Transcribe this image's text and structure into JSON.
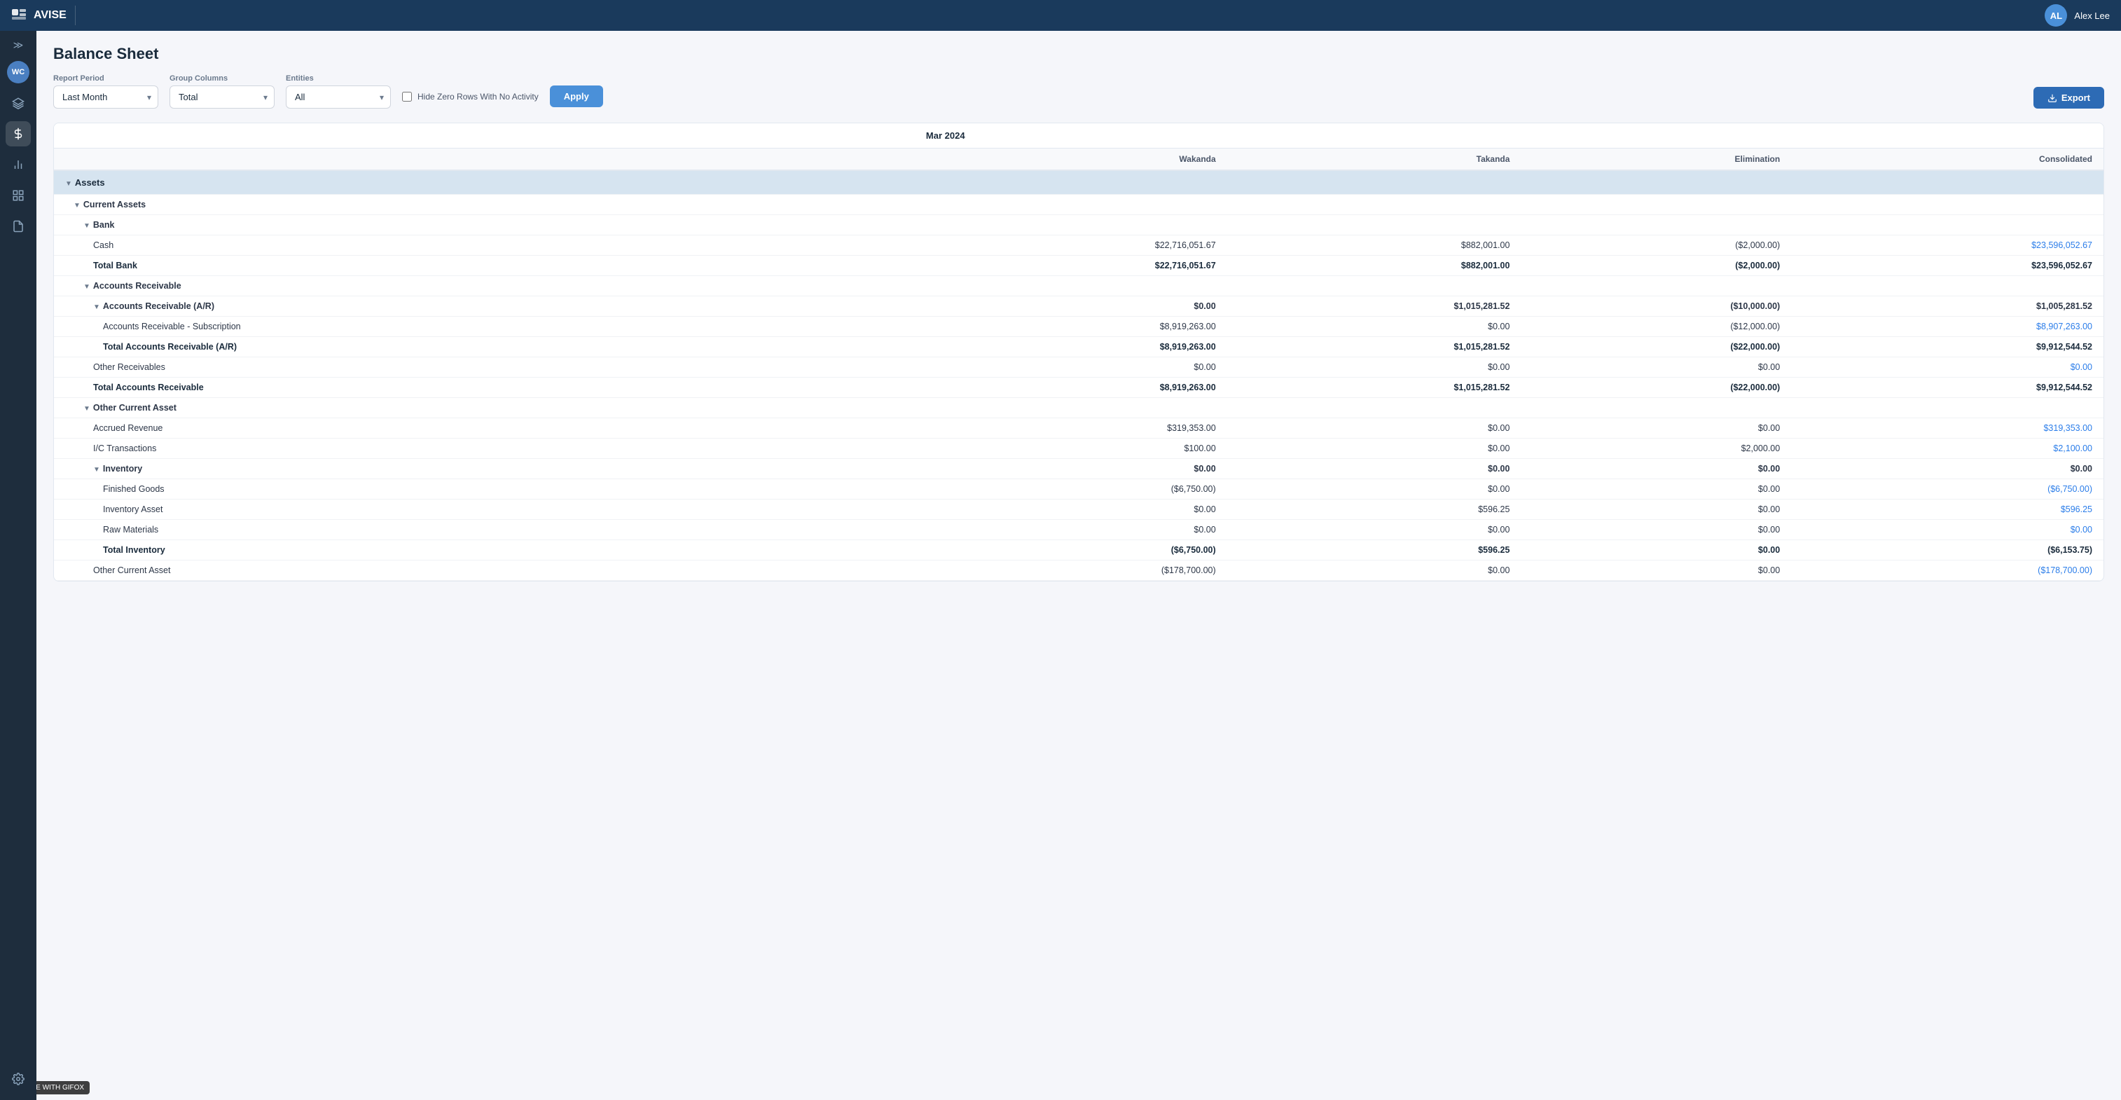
{
  "app": {
    "name": "AVISE",
    "user": "Alex Lee",
    "user_initials": "AL"
  },
  "page": {
    "title": "Balance Sheet"
  },
  "filters": {
    "report_period_label": "Report Period",
    "report_period_value": "Last Month",
    "group_columns_label": "Group Columns",
    "group_columns_value": "Total",
    "entities_label": "Entities",
    "entities_value": "All",
    "hide_zero_label": "Hide Zero Rows With No Activity",
    "apply_label": "Apply",
    "export_label": "Export"
  },
  "table": {
    "date_header": "Mar 2024",
    "columns": [
      "",
      "Wakanda",
      "Takanda",
      "Elimination",
      "Consolidated"
    ],
    "sections": [
      {
        "name": "Assets",
        "rows": [
          {
            "type": "category",
            "indent": 1,
            "label": "Current Assets",
            "chevron": true,
            "wakanda": "",
            "takanda": "",
            "elimination": "",
            "consolidated": ""
          },
          {
            "type": "subcategory",
            "indent": 2,
            "label": "Bank",
            "chevron": true,
            "wakanda": "",
            "takanda": "",
            "elimination": "",
            "consolidated": ""
          },
          {
            "type": "data",
            "indent": 3,
            "label": "Cash",
            "wakanda": "$22,716,051.67",
            "takanda": "$882,001.00",
            "elimination": "($2,000.00)",
            "consolidated": "$23,596,052.67",
            "consolidated_blue": true
          },
          {
            "type": "total",
            "indent": 3,
            "label": "Total Bank",
            "wakanda": "$22,716,051.67",
            "takanda": "$882,001.00",
            "elimination": "($2,000.00)",
            "consolidated": "$23,596,052.67"
          },
          {
            "type": "subcategory",
            "indent": 2,
            "label": "Accounts Receivable",
            "chevron": true,
            "wakanda": "",
            "takanda": "",
            "elimination": "",
            "consolidated": ""
          },
          {
            "type": "subcategory",
            "indent": 3,
            "label": "Accounts Receivable (A/R)",
            "chevron": true,
            "wakanda": "$0.00",
            "takanda": "$1,015,281.52",
            "elimination": "($10,000.00)",
            "consolidated": "$1,005,281.52",
            "consolidated_blue": true
          },
          {
            "type": "data",
            "indent": 4,
            "label": "Accounts Receivable - Subscription",
            "wakanda": "$8,919,263.00",
            "takanda": "$0.00",
            "elimination": "($12,000.00)",
            "consolidated": "$8,907,263.00",
            "consolidated_blue": true
          },
          {
            "type": "total",
            "indent": 4,
            "label": "Total Accounts Receivable (A/R)",
            "wakanda": "$8,919,263.00",
            "takanda": "$1,015,281.52",
            "elimination": "($22,000.00)",
            "consolidated": "$9,912,544.52"
          },
          {
            "type": "data",
            "indent": 3,
            "label": "Other Receivables",
            "wakanda": "$0.00",
            "takanda": "$0.00",
            "elimination": "$0.00",
            "consolidated": "$0.00",
            "consolidated_blue": true
          },
          {
            "type": "total",
            "indent": 3,
            "label": "Total Accounts Receivable",
            "wakanda": "$8,919,263.00",
            "takanda": "$1,015,281.52",
            "elimination": "($22,000.00)",
            "consolidated": "$9,912,544.52"
          },
          {
            "type": "subcategory",
            "indent": 2,
            "label": "Other Current Asset",
            "chevron": true,
            "wakanda": "",
            "takanda": "",
            "elimination": "",
            "consolidated": ""
          },
          {
            "type": "data",
            "indent": 3,
            "label": "Accrued Revenue",
            "wakanda": "$319,353.00",
            "takanda": "$0.00",
            "elimination": "$0.00",
            "consolidated": "$319,353.00",
            "consolidated_blue": true
          },
          {
            "type": "data",
            "indent": 3,
            "label": "I/C Transactions",
            "wakanda": "$100.00",
            "takanda": "$0.00",
            "elimination": "$2,000.00",
            "consolidated": "$2,100.00",
            "consolidated_blue": true
          },
          {
            "type": "subcategory",
            "indent": 3,
            "label": "Inventory",
            "chevron": true,
            "wakanda": "$0.00",
            "takanda": "$0.00",
            "elimination": "$0.00",
            "consolidated": "$0.00",
            "consolidated_blue": true
          },
          {
            "type": "data",
            "indent": 4,
            "label": "Finished Goods",
            "wakanda": "($6,750.00)",
            "takanda": "$0.00",
            "elimination": "$0.00",
            "consolidated": "($6,750.00)",
            "consolidated_blue": true
          },
          {
            "type": "data",
            "indent": 4,
            "label": "Inventory Asset",
            "wakanda": "$0.00",
            "takanda": "$596.25",
            "elimination": "$0.00",
            "consolidated": "$596.25",
            "consolidated_blue": true
          },
          {
            "type": "data",
            "indent": 4,
            "label": "Raw Materials",
            "wakanda": "$0.00",
            "takanda": "$0.00",
            "elimination": "$0.00",
            "consolidated": "$0.00",
            "consolidated_blue": true
          },
          {
            "type": "total",
            "indent": 4,
            "label": "Total Inventory",
            "wakanda": "($6,750.00)",
            "takanda": "$596.25",
            "elimination": "$0.00",
            "consolidated": "($6,153.75)"
          },
          {
            "type": "data",
            "indent": 3,
            "label": "Other Current Asset",
            "wakanda": "($178,700.00)",
            "takanda": "$0.00",
            "elimination": "$0.00",
            "consolidated": "($178,700.00)",
            "consolidated_blue": true
          }
        ]
      }
    ]
  },
  "watermark": "MADE WITH GIFOX"
}
